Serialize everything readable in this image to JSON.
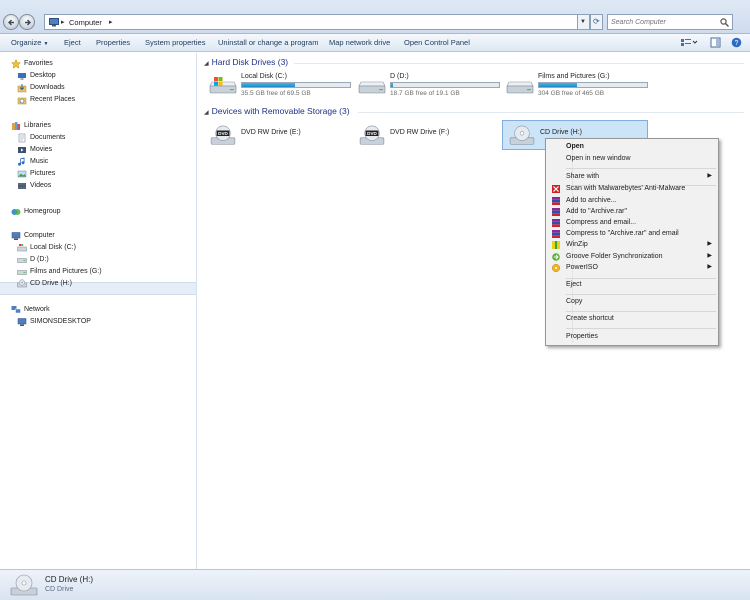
{
  "address": {
    "crumb": "Computer",
    "search_placeholder": "Search Computer"
  },
  "commands": [
    {
      "label": "Organize"
    },
    {
      "label": "Eject"
    },
    {
      "label": "Properties"
    },
    {
      "label": "System properties"
    },
    {
      "label": "Uninstall or change a program"
    },
    {
      "label": "Map network drive"
    },
    {
      "label": "Open Control Panel"
    }
  ],
  "nav": {
    "favorites": {
      "label": "Favorites",
      "items": [
        "Desktop",
        "Downloads",
        "Recent Places"
      ]
    },
    "libraries": {
      "label": "Libraries",
      "items": [
        "Documents",
        "Movies",
        "Music",
        "Pictures",
        "Videos"
      ]
    },
    "homegroup": "Homegroup",
    "computer": {
      "label": "Computer",
      "items": [
        "Local Disk (C:)",
        "D (D:)",
        "Films and Pictures (G:)",
        "CD Drive (H:)"
      ]
    },
    "network": {
      "label": "Network",
      "items": [
        "SIMONSDESKTOP"
      ]
    }
  },
  "hard_disks": {
    "heading": "Hard Disk Drives (3)",
    "drives": [
      {
        "name": "Local Disk (C:)",
        "free": "35.5 GB free of 69.5 GB",
        "used_fraction": 0.49
      },
      {
        "name": "D (D:)",
        "free": "18.7 GB free of 19.1 GB",
        "used_fraction": 0.02
      },
      {
        "name": "Films and Pictures (G:)",
        "free": "304 GB free of 465 GB",
        "used_fraction": 0.35
      }
    ]
  },
  "removable": {
    "heading": "Devices with Removable Storage (3)",
    "drives": [
      {
        "name": "DVD RW Drive (E:)"
      },
      {
        "name": "DVD RW Drive (F:)"
      },
      {
        "name": "CD Drive (H:)"
      }
    ]
  },
  "context_menu": {
    "open": "Open",
    "open_new_window": "Open in new window",
    "share_with": "Share with",
    "scan_malwarebytes": "Scan with Malwarebytes' Anti-Malware",
    "add_archive": "Add to archive...",
    "add_archive_rar": "Add to \"Archive.rar\"",
    "compress_email": "Compress and email...",
    "compress_rar_email": "Compress to \"Archive.rar\" and email",
    "winzip": "WinZip",
    "groove": "Groove Folder Synchronization",
    "poweriso": "PowerISO",
    "eject": "Eject",
    "copy": "Copy",
    "create_shortcut": "Create shortcut",
    "properties": "Properties"
  },
  "details": {
    "name": "CD Drive (H:)",
    "type": "CD Drive"
  },
  "colors": {
    "heading": "#1e3287",
    "selection": "#cce4f7",
    "bar_fill": "#26a0da"
  }
}
